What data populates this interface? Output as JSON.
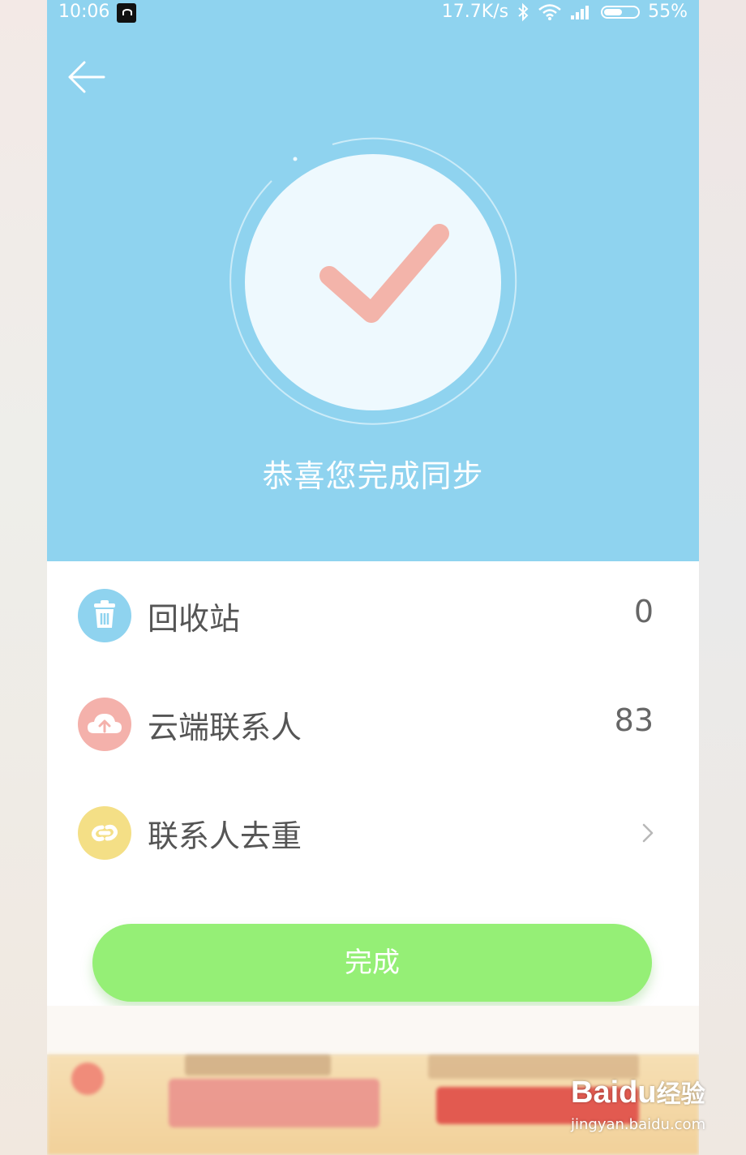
{
  "status_bar": {
    "time": "10:06",
    "network_speed": "17.7K/s",
    "battery_percent": "55%",
    "icons": [
      "bluetooth-icon",
      "wifi-icon",
      "signal-icon",
      "battery-icon"
    ]
  },
  "header": {
    "title": "恭喜您完成同步",
    "back_icon": "arrow-left-icon",
    "check_icon": "checkmark-icon"
  },
  "list": [
    {
      "label": "回收站",
      "value": "0",
      "icon": "trash-icon",
      "icon_color": "#8fd3ef"
    },
    {
      "label": "云端联系人",
      "value": "83",
      "icon": "cloud-upload-icon",
      "icon_color": "#f4b1ab"
    },
    {
      "label": "联系人去重",
      "value": "",
      "icon": "link-icon",
      "icon_color": "#f4df86",
      "chevron": "chevron-right-icon"
    }
  ],
  "done_button": {
    "label": "完成",
    "color": "#95ef76"
  },
  "colors": {
    "header_bg": "#8fd3ef",
    "check": "#f3b4aa",
    "circle_fill": "#eef9fe"
  },
  "watermark": {
    "logo": "Bai",
    "logo_mark": "du",
    "sub": "经验",
    "url": "jingyan.baidu.com"
  }
}
